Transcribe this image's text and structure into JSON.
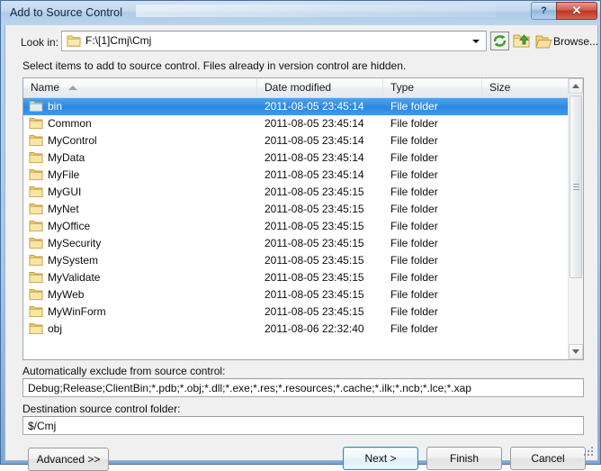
{
  "window": {
    "title": "Add to Source Control",
    "help_button": "?",
    "close_button": "✕"
  },
  "toolbar": {
    "lookin_label": "Look in:",
    "lookin_path": "F:\\[1]Cmj\\Cmj",
    "refresh_icon": "refresh-icon",
    "up_folder_icon": "up-one-level-icon",
    "browse_folder_icon": "browse-folder-icon",
    "browse_label": "Browse..."
  },
  "instruction": "Select items to add to source control. Files already in version control are hidden.",
  "listview": {
    "columns": [
      {
        "label": "Name",
        "sorted": "asc"
      },
      {
        "label": "Date modified",
        "sorted": ""
      },
      {
        "label": "Type",
        "sorted": ""
      },
      {
        "label": "Size",
        "sorted": ""
      }
    ],
    "rows": [
      {
        "name": "bin",
        "date": "2011-08-05 23:45:14",
        "type": "File folder",
        "size": "",
        "selected": true
      },
      {
        "name": "Common",
        "date": "2011-08-05 23:45:14",
        "type": "File folder",
        "size": "",
        "selected": false
      },
      {
        "name": "MyControl",
        "date": "2011-08-05 23:45:14",
        "type": "File folder",
        "size": "",
        "selected": false
      },
      {
        "name": "MyData",
        "date": "2011-08-05 23:45:14",
        "type": "File folder",
        "size": "",
        "selected": false
      },
      {
        "name": "MyFile",
        "date": "2011-08-05 23:45:14",
        "type": "File folder",
        "size": "",
        "selected": false
      },
      {
        "name": "MyGUI",
        "date": "2011-08-05 23:45:15",
        "type": "File folder",
        "size": "",
        "selected": false
      },
      {
        "name": "MyNet",
        "date": "2011-08-05 23:45:15",
        "type": "File folder",
        "size": "",
        "selected": false
      },
      {
        "name": "MyOffice",
        "date": "2011-08-05 23:45:15",
        "type": "File folder",
        "size": "",
        "selected": false
      },
      {
        "name": "MySecurity",
        "date": "2011-08-05 23:45:15",
        "type": "File folder",
        "size": "",
        "selected": false
      },
      {
        "name": "MySystem",
        "date": "2011-08-05 23:45:15",
        "type": "File folder",
        "size": "",
        "selected": false
      },
      {
        "name": "MyValidate",
        "date": "2011-08-05 23:45:15",
        "type": "File folder",
        "size": "",
        "selected": false
      },
      {
        "name": "MyWeb",
        "date": "2011-08-05 23:45:15",
        "type": "File folder",
        "size": "",
        "selected": false
      },
      {
        "name": "MyWinForm",
        "date": "2011-08-05 23:45:15",
        "type": "File folder",
        "size": "",
        "selected": false
      },
      {
        "name": "obj",
        "date": "2011-08-06 22:32:40",
        "type": "File folder",
        "size": "",
        "selected": false
      }
    ]
  },
  "exclude": {
    "label": "Automatically exclude from source control:",
    "value": "Debug;Release;ClientBin;*.pdb;*.obj;*.dll;*.exe;*.res;*.resources;*.cache;*.ilk;*.ncb;*.lce;*.xap"
  },
  "destination": {
    "label": "Destination source control folder:",
    "value": "$/Cmj"
  },
  "buttons": {
    "advanced": "Advanced >>",
    "next": "Next >",
    "finish": "Finish",
    "cancel": "Cancel"
  },
  "colors": {
    "selection_blue": "#2e8ce4",
    "title_blue": "#b9d3ef",
    "close_red": "#bd3626",
    "default_button_border": "#2c8dba"
  }
}
